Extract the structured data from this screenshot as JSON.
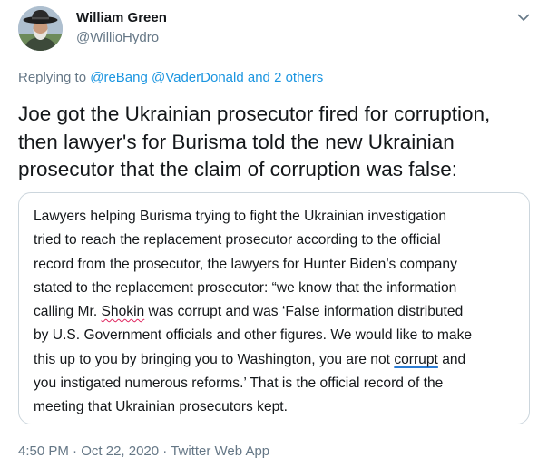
{
  "author": {
    "name": "William Green",
    "handle": "@WillioHydro"
  },
  "icons": {
    "avatar": "avatar-photo",
    "menu": "chevron-down-icon"
  },
  "colors": {
    "link": "#1b95e0",
    "secondary_text": "#657786",
    "border": "#ccd6dd"
  },
  "replying": {
    "prefix": "Replying to",
    "mention1": "@reBang",
    "mention2": "@VaderDonald",
    "connector": "and",
    "others": "2 others"
  },
  "tweet_text": {
    "line1": "Joe got the Ukrainian prosecutor fired for corruption,",
    "line2": "then lawyer's for Burisma told the new Ukrainian",
    "line3": "prosecutor that the claim of corruption was false:"
  },
  "quote": {
    "line1": "Lawyers helping Burisma trying to fight the Ukrainian investigation",
    "line2": "tried to reach the replacement prosecutor according to the official",
    "line3": "record from the prosecutor, the lawyers for Hunter Biden’s company",
    "line4": "stated to the replacement prosecutor: “we know that the information",
    "line5a": "calling Mr. ",
    "line5b": "Shokin",
    "line5c": " was corrupt and was ‘False information distributed",
    "line6": "by U.S. Government officials and other figures. We would like to make",
    "line7a": "this up to you by bringing you to Washington, you are not ",
    "line7b": "corrupt",
    "line7c": " and",
    "line8": "you instigated numerous reforms.’ That is the official record of the",
    "line9": "meeting that Ukrainian prosecutors kept."
  },
  "meta": {
    "time": "4:50 PM",
    "date": "Oct 22, 2020",
    "source": "Twitter Web App",
    "separator": "·"
  }
}
